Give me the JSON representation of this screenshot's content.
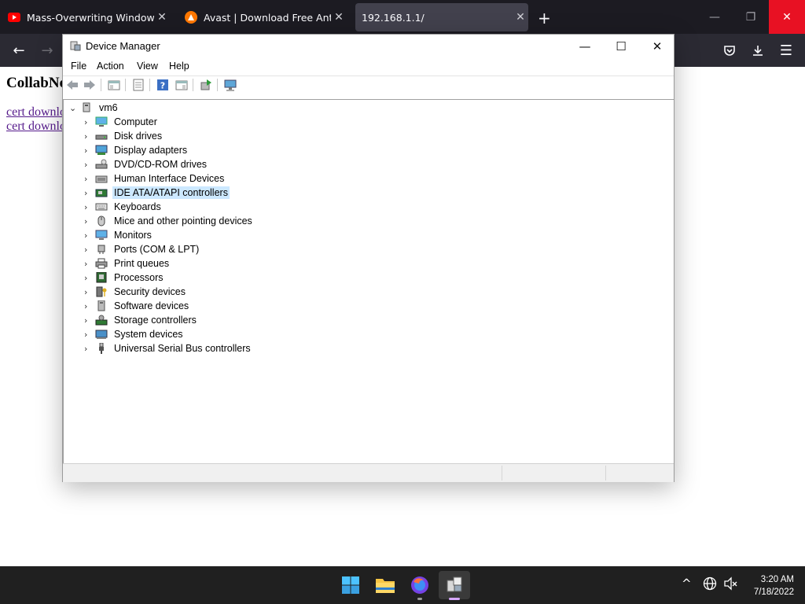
{
  "browser": {
    "tabs": [
      {
        "title": "Mass-Overwriting Windows Re",
        "favicon": "youtube-icon",
        "active": false
      },
      {
        "title": "Avast | Download Free Antivirus",
        "favicon": "avast-icon",
        "active": false
      },
      {
        "title": "192.168.1.1/",
        "favicon": "",
        "active": true
      }
    ],
    "new_tab": "+",
    "window_controls": {
      "minimize": "—",
      "restore": "❐",
      "close": "✕"
    },
    "nav": {
      "back": "←",
      "forward": "→",
      "pocket": "pocket-icon",
      "downloads": "download-icon",
      "menu": "☰"
    }
  },
  "page": {
    "heading": "CollabNe",
    "links": [
      "cert downlo",
      "cert downlo"
    ]
  },
  "device_manager": {
    "title": "Device Manager",
    "controls": {
      "minimize": "—",
      "maximize": "☐",
      "close": "✕"
    },
    "menu": [
      "File",
      "Action",
      "View",
      "Help"
    ],
    "toolbar": [
      "back-icon",
      "forward-icon",
      "show-hide-console-tree-icon",
      "properties-icon",
      "help-icon",
      "action-pane-icon",
      "update-driver-icon",
      "scan-hardware-icon"
    ],
    "tree": {
      "root": "vm6",
      "items": [
        {
          "label": "Computer",
          "icon": "computer-icon"
        },
        {
          "label": "Disk drives",
          "icon": "disk-drive-icon"
        },
        {
          "label": "Display adapters",
          "icon": "display-adapter-icon"
        },
        {
          "label": "DVD/CD-ROM drives",
          "icon": "dvd-drive-icon"
        },
        {
          "label": "Human Interface Devices",
          "icon": "hid-icon"
        },
        {
          "label": "IDE ATA/ATAPI controllers",
          "icon": "ide-controller-icon",
          "selected": true
        },
        {
          "label": "Keyboards",
          "icon": "keyboard-icon"
        },
        {
          "label": "Mice and other pointing devices",
          "icon": "mouse-icon"
        },
        {
          "label": "Monitors",
          "icon": "monitor-icon"
        },
        {
          "label": "Ports (COM & LPT)",
          "icon": "port-icon"
        },
        {
          "label": "Print queues",
          "icon": "printer-icon"
        },
        {
          "label": "Processors",
          "icon": "processor-icon"
        },
        {
          "label": "Security devices",
          "icon": "security-device-icon"
        },
        {
          "label": "Software devices",
          "icon": "software-device-icon"
        },
        {
          "label": "Storage controllers",
          "icon": "storage-controller-icon"
        },
        {
          "label": "System devices",
          "icon": "system-device-icon"
        },
        {
          "label": "Universal Serial Bus controllers",
          "icon": "usb-icon"
        }
      ]
    }
  },
  "taskbar": {
    "apps": [
      "windows-start-icon",
      "file-explorer-icon",
      "firefox-icon",
      "device-manager-icon"
    ],
    "tray": [
      "chevron-up-icon",
      "network-icon",
      "volume-muted-icon"
    ],
    "time": "3:20 AM",
    "date": "7/18/2022"
  },
  "colors": {
    "browser_tab_bg": "#1c1b22",
    "browser_nav_bg": "#2b2a33",
    "active_tab": "#42414d",
    "close_hover_red": "#e81123",
    "selection": "#cce8ff",
    "taskbar": "#202020",
    "visited_link": "#551a8b"
  }
}
